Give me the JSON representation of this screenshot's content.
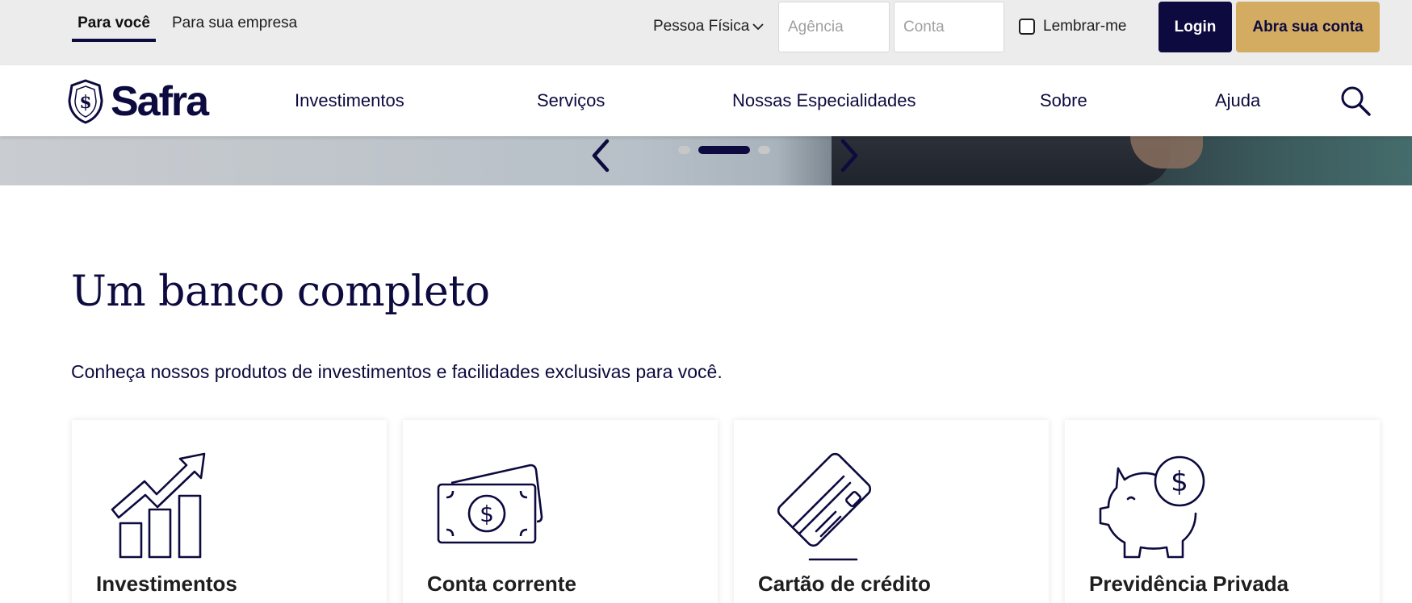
{
  "topbar": {
    "segments": [
      {
        "label": "Para você",
        "active": true
      },
      {
        "label": "Para sua empresa",
        "active": false
      }
    ],
    "person_type": "Pessoa Física",
    "agencia_placeholder": "Agência",
    "conta_placeholder": "Conta",
    "remember_label": "Lembrar-me",
    "login_label": "Login",
    "open_account_label": "Abra sua conta"
  },
  "brand": {
    "name": "Safra",
    "colors": {
      "navy": "#0c0a3e",
      "gold": "#d3ac62"
    }
  },
  "nav": {
    "items": [
      "Investimentos",
      "Serviços",
      "Nossas Especialidades",
      "Sobre",
      "Ajuda"
    ],
    "search_icon": "search-icon"
  },
  "carousel": {
    "active_slide": 2,
    "slide_count": 3
  },
  "section": {
    "title": "Um banco completo",
    "subtitle": "Conheça nossos produtos de investimentos e facilidades exclusivas para você."
  },
  "cards": [
    {
      "title": "Investimentos",
      "icon": "growth-chart-icon"
    },
    {
      "title": "Conta corrente",
      "icon": "cash-icon"
    },
    {
      "title": "Cartão de crédito",
      "icon": "credit-card-icon"
    },
    {
      "title": "Previdência Privada",
      "icon": "piggy-bank-icon"
    }
  ]
}
